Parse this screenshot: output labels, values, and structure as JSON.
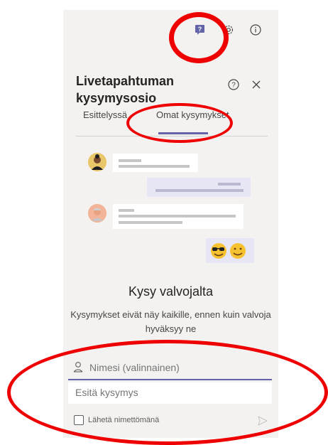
{
  "topbar": {
    "icons": [
      "qa-chat-icon",
      "gear-icon",
      "info-icon"
    ]
  },
  "header": {
    "title": "Livetapahtuman kysymysosio",
    "help_icon": "help-circle-icon",
    "close_icon": "close-icon"
  },
  "tabs": [
    {
      "label": "Esittelyssä",
      "active": false
    },
    {
      "label": "Omat kysymykset",
      "active": true
    }
  ],
  "illustration": {
    "emojis": [
      "😎",
      "🙂"
    ]
  },
  "main": {
    "heading": "Kysy valvojalta",
    "description": "Kysymykset eivät näy kaikille, ennen kuin valvoja hyväksyy ne"
  },
  "form": {
    "name_placeholder": "Nimesi (valinnainen)",
    "question_placeholder": "Esitä kysymys",
    "anonymous_label": "Lähetä nimettömänä",
    "person_icon": "person-icon",
    "send_icon": "send-icon"
  },
  "colors": {
    "accent": "#6264a7",
    "panel_bg": "#f3f2f1",
    "annotation": "#ee0000"
  }
}
